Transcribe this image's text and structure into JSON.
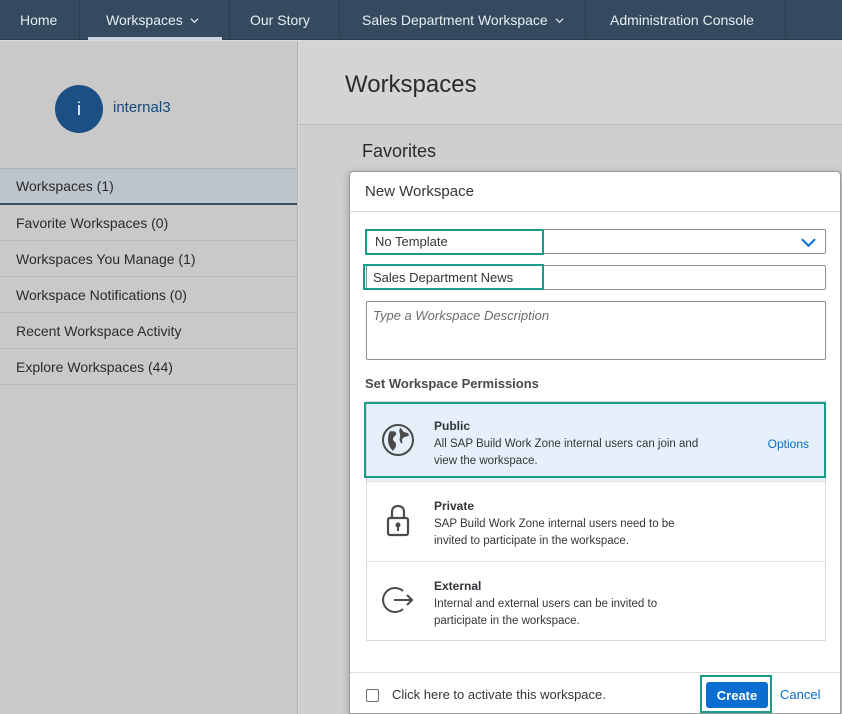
{
  "nav": {
    "home": "Home",
    "workspaces": "Workspaces",
    "our_story": "Our Story",
    "sales_workspace": "Sales Department Workspace",
    "admin_console": "Administration Console"
  },
  "profile": {
    "initial": "i",
    "username": "internal3"
  },
  "sidebar": {
    "items": [
      {
        "label": "Workspaces (1)"
      },
      {
        "label": "Favorite Workspaces (0)"
      },
      {
        "label": "Workspaces You Manage (1)"
      },
      {
        "label": "Workspace Notifications (0)"
      },
      {
        "label": "Recent Workspace Activity"
      },
      {
        "label": "Explore Workspaces (44)"
      }
    ]
  },
  "main": {
    "title": "Workspaces",
    "favorites": "Favorites"
  },
  "dialog": {
    "title": "New Workspace",
    "template_value": "No Template",
    "name_value": "Sales Department News",
    "description_placeholder": "Type a Workspace Description",
    "permissions_title": "Set Workspace Permissions",
    "permissions": [
      {
        "name": "Public",
        "desc": "All SAP Build Work Zone internal users can join and view the workspace.",
        "icon": "globe-icon",
        "selected": true
      },
      {
        "name": "Private",
        "desc": "SAP Build Work Zone internal users need to be invited to participate in the workspace.",
        "icon": "lock-icon"
      },
      {
        "name": "External",
        "desc": "Internal and external users can be invited to participate in the workspace.",
        "icon": "exit-icon"
      }
    ],
    "options_label": "Options",
    "activate_label": "Click here to activate this workspace.",
    "create_label": "Create",
    "cancel_label": "Cancel"
  },
  "colors": {
    "nav_bg": "#354a5f",
    "accent": "#0a6ed1",
    "highlight": "#1a9b8a",
    "avatar": "#1c4f84"
  }
}
